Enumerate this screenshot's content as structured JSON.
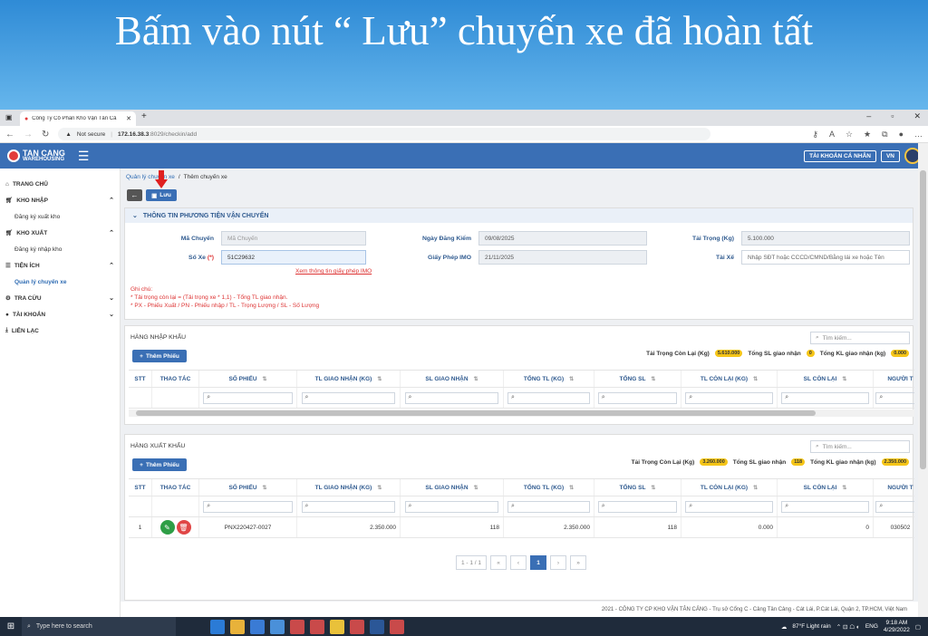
{
  "slide": {
    "title": "Bấm vào nút “ Lưu” chuyến xe đã hoàn tất"
  },
  "browser": {
    "tab_title": "Công Ty Cổ Phần Kho Vận Tân Cả",
    "not_secure": "Not secure",
    "url_host": "172.16.38.3",
    "url_path": ":8029/checkin/add"
  },
  "header": {
    "logo_line1": "TAN CANG",
    "logo_line2": "WAREHOUSING",
    "account_btn": "TÀI KHOẢN CÁ NHÂN",
    "lang_btn": "VN"
  },
  "sidebar": {
    "home": "TRANG CHỦ",
    "kho_nhap": "KHO NHẬP",
    "dk_xuat_kho": "Đăng ký xuất kho",
    "kho_xuat": "KHO XUẤT",
    "dk_nhap_kho": "Đăng ký nhập kho",
    "tien_ich": "TIỆN ÍCH",
    "ql_chuyen_xe": "Quản lý chuyến xe",
    "tra_cuu": "TRA CỨU",
    "tai_khoan": "TÀI KHOẢN",
    "lien_lac": "LIÊN LẠC"
  },
  "breadcrumb": {
    "parent": "Quản lý chuyến xe",
    "sep": "/",
    "current": "Thêm chuyến xe"
  },
  "toolbar": {
    "save": "Lưu"
  },
  "vehicle": {
    "title": "THÔNG TIN PHƯƠNG TIỆN VẬN CHUYỂN",
    "ma_chuyen_label": "Mã Chuyến",
    "ma_chuyen_ph": "Mã Chuyến",
    "so_xe_label": "Số Xe",
    "so_xe_req": "(*)",
    "so_xe_value": "51C29632",
    "ngay_dk_label": "Ngày Đăng Kiểm",
    "ngay_dk_value": "09/08/2025",
    "giay_phep_label": "Giấy Phép IMO",
    "giay_phep_value": "21/11/2025",
    "tai_trong_label": "Tải Trọng (Kg)",
    "tai_trong_value": "5.100.000",
    "tai_xe_label": "Tài Xế",
    "tai_xe_ph": "Nhập SĐT hoặc CCCD/CMND/Bằng lái xe hoặc Tên",
    "imo_link": "Xem thông tin giấy phép IMO",
    "note_title": "Ghi chú:",
    "note_1": "* Tải trọng còn lại = (Tải trọng xe * 1,1) - Tổng TL giao nhận.",
    "note_2": "* PX - Phiếu Xuất / PN - Phiếu nhập / TL - Trọng Lượng / SL - Số Lượng"
  },
  "import_section": {
    "title": "HÀNG NHẬP KHẨU",
    "search_ph": "Tìm kiếm...",
    "add_btn": "Thêm Phiếu",
    "remaining_label": "Tải Trọng Còn Lại (Kg)",
    "remaining_value": "5.610.000",
    "total_sl_label": "Tổng SL giao nhận",
    "total_sl_value": "0",
    "total_kl_label": "Tổng KL giao nhận (kg)",
    "total_kl_value": "0.000"
  },
  "export_section": {
    "title": "HÀNG XUẤT KHẨU",
    "search_ph": "Tìm kiếm...",
    "add_btn": "Thêm Phiếu",
    "remaining_label": "Tải Trọng Còn Lại (Kg)",
    "remaining_value": "3.260.000",
    "total_sl_label": "Tổng SL giao nhận",
    "total_sl_value": "118",
    "total_kl_label": "Tổng KL giao nhận (kg)",
    "total_kl_value": "2.350.000"
  },
  "columns": [
    "STT",
    "THAO TÁC",
    "SỐ PHIẾU",
    "TL GIAO NHẬN (KG)",
    "SL GIAO NHẬN",
    "TỔNG TL (KG)",
    "TỔNG SL",
    "TL CÒN LẠI (KG)",
    "SL CÒN LẠI",
    "NGƯỜI T"
  ],
  "export_row": {
    "stt": "1",
    "so_phieu": "PNX220427-0027",
    "tl_gn": "2.350.000",
    "sl_gn": "118",
    "tong_tl": "2.350.000",
    "tong_sl": "118",
    "tl_con": "0.000",
    "sl_con": "0",
    "nguoi": "030502"
  },
  "pager": {
    "info": "1 - 1 / 1",
    "current": "1",
    "first": "«",
    "prev": "‹",
    "next": "›",
    "last": "»"
  },
  "footer": "2021 - CÔNG TY CP KHO VẬN TÂN CẢNG - Trụ sở Cổng C - Cảng Tân Cảng - Cát Lái, P.Cát Lái, Quận 2, TP.HCM, Việt Nam",
  "taskbar": {
    "search": "Type here to search",
    "weather": "87°F  Light rain",
    "lang": "ENG",
    "time": "9:18 AM",
    "date": "4/29/2022"
  },
  "colors": {
    "accent": "#3a6fb5",
    "danger": "#d33",
    "pill": "#f5c518"
  }
}
